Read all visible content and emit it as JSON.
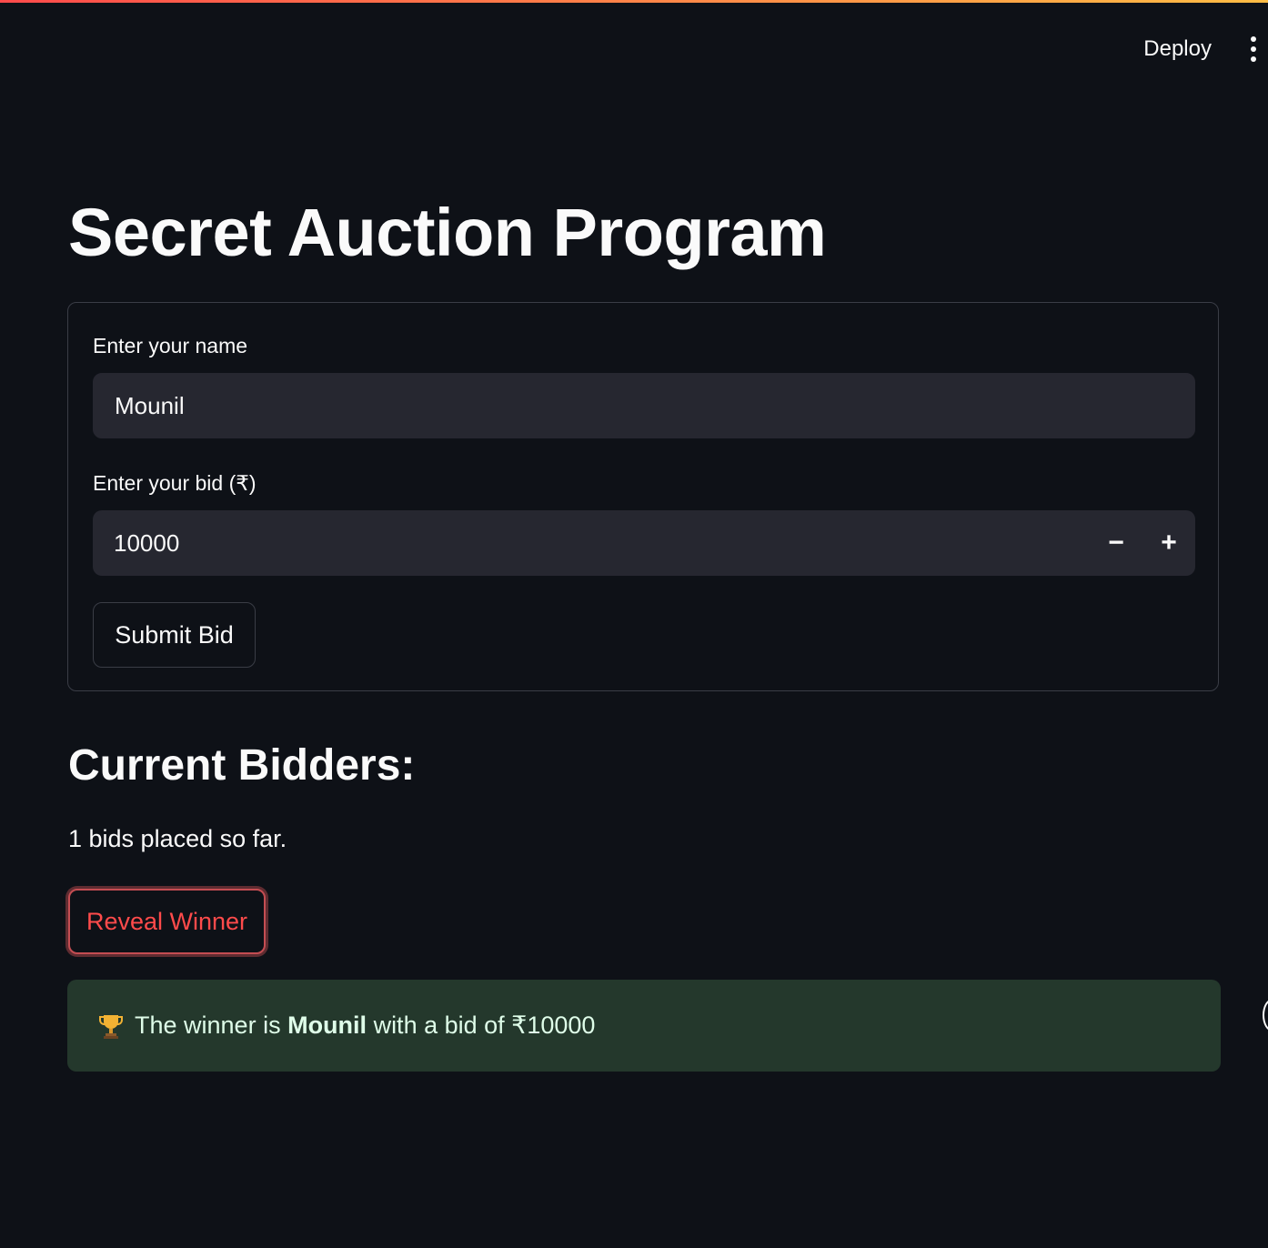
{
  "header": {
    "deploy_label": "Deploy",
    "menu_icon": "vertical-dots-icon"
  },
  "page": {
    "title": "Secret Auction Program"
  },
  "form": {
    "name_label": "Enter your name",
    "name_value": "Mounil",
    "bid_label": "Enter your bid (₹)",
    "bid_value": "10000",
    "decrement_label": "−",
    "increment_label": "+",
    "submit_label": "Submit Bid"
  },
  "bidders": {
    "heading": "Current Bidders:",
    "count_text": "1 bids placed so far.",
    "reveal_label": "Reveal Winner"
  },
  "result": {
    "icon": "trophy-icon",
    "prefix": "The winner is ",
    "winner_name": "Mounil",
    "suffix": " with a bid of ₹10000",
    "bg_color": "#24382c"
  },
  "colors": {
    "background": "#0e1117",
    "input_bg": "#262730",
    "accent": "#ff4b4b"
  }
}
